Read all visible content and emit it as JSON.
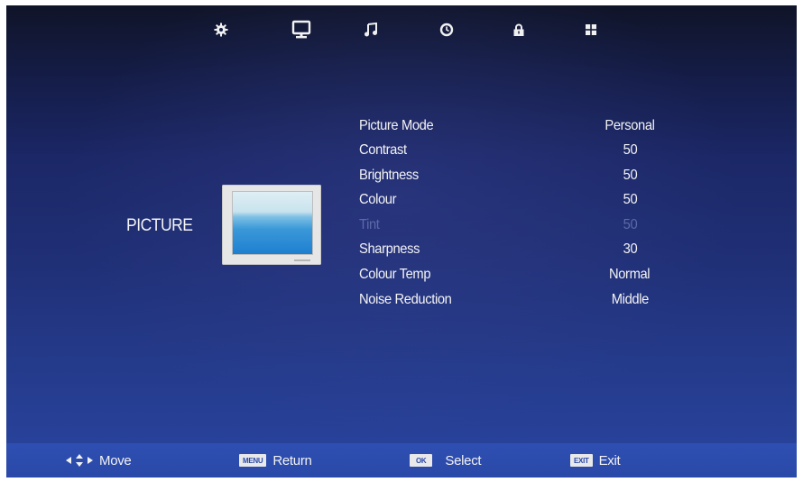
{
  "tabs": [
    {
      "icon": "setup-gear-icon",
      "active": false
    },
    {
      "icon": "picture-monitor-icon",
      "active": true
    },
    {
      "icon": "sound-note-icon",
      "active": false
    },
    {
      "icon": "time-clock-icon",
      "active": false
    },
    {
      "icon": "lock-icon",
      "active": false
    },
    {
      "icon": "feature-grid-icon",
      "active": false
    }
  ],
  "section": {
    "title": "PICTURE"
  },
  "settings": [
    {
      "label": "Picture Mode",
      "value": "Personal",
      "enabled": true
    },
    {
      "label": "Contrast",
      "value": "50",
      "enabled": true
    },
    {
      "label": "Brightness",
      "value": "50",
      "enabled": true
    },
    {
      "label": "Colour",
      "value": "50",
      "enabled": true
    },
    {
      "label": "Tint",
      "value": "50",
      "enabled": false
    },
    {
      "label": "Sharpness",
      "value": "30",
      "enabled": true
    },
    {
      "label": "Colour Temp",
      "value": "Normal",
      "enabled": true
    },
    {
      "label": "Noise Reduction",
      "value": "Middle",
      "enabled": true
    }
  ],
  "help": {
    "move": {
      "label": "Move"
    },
    "return": {
      "key": "MENU",
      "label": "Return"
    },
    "select": {
      "key": "OK",
      "label": "Select"
    },
    "exit": {
      "key": "EXIT",
      "label": "Exit"
    }
  },
  "colors": {
    "background": "#203077",
    "help_bar": "#2a49a8",
    "text": "#f4f4f4",
    "disabled_text": "#5c6aa8"
  }
}
